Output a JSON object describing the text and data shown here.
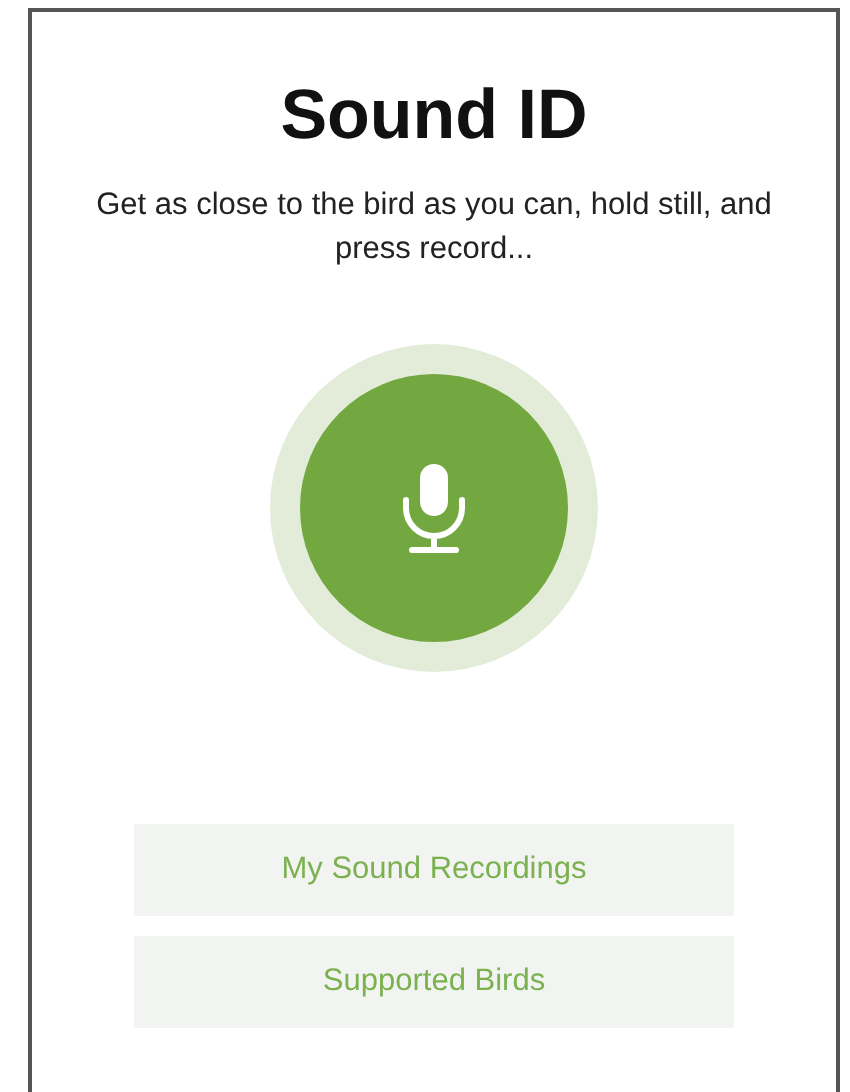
{
  "title": "Sound ID",
  "instructions": "Get as close to the bird as you can, hold still, and press record...",
  "buttons": [
    {
      "label": "My Sound Recordings"
    },
    {
      "label": "Supported Birds"
    }
  ]
}
